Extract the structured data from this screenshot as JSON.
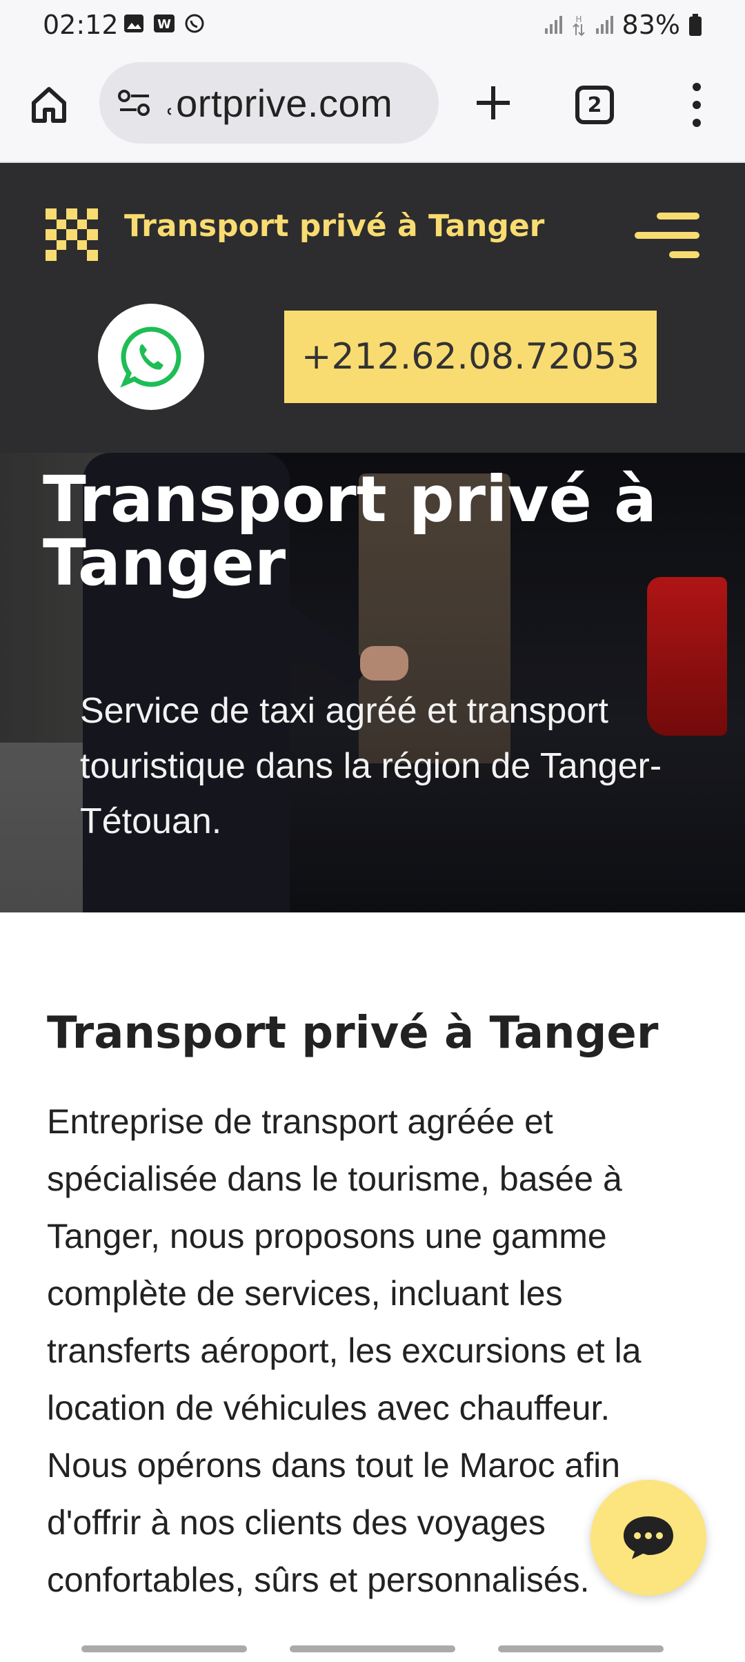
{
  "status_bar": {
    "time": "02:12",
    "battery": "83%",
    "icons": [
      "gallery-icon",
      "w-app-icon",
      "whatsapp-status-icon",
      "signal-icon",
      "data-transfer-icon",
      "signal-icon-2",
      "battery-icon"
    ]
  },
  "browser": {
    "url": "˓ortprive.com",
    "tab_count": "2"
  },
  "header": {
    "site_title": "Transport privé à Tanger",
    "phone_label": "+212.62.08.72053",
    "accent_color": "#f9dc71",
    "background_color": "#2d2d2f"
  },
  "hero": {
    "title": "Transport privé à Tanger",
    "subtitle": "Service de taxi agréé et transport touristique dans la région de Tanger-Tétouan."
  },
  "content": {
    "heading": "Transport privé à Tanger",
    "body": "Entreprise de transport agréée et spécialisée dans le tourisme, basée à Tanger, nous proposons une gamme complète de services, incluant les transferts aéroport, les excursions et la location de véhicules avec chauffeur. Nous opérons dans tout le Maroc afin d'offrir à nos clients des voyages confortables, sûrs et personnalisés."
  }
}
